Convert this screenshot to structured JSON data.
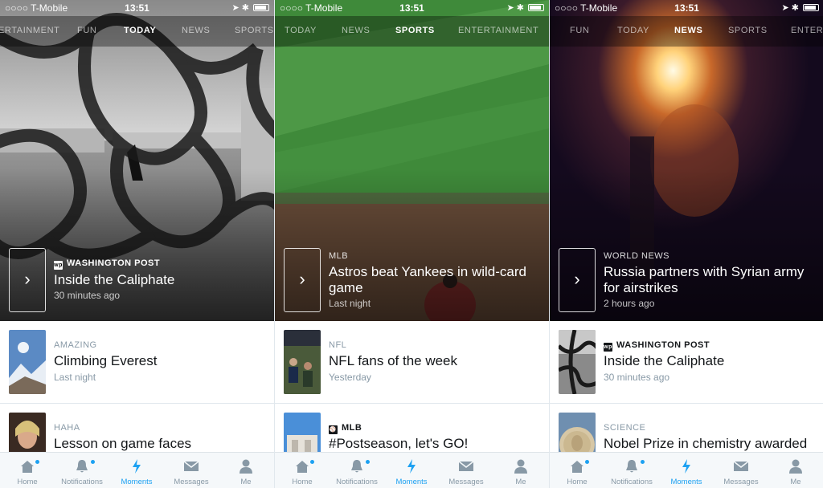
{
  "status": {
    "carrier": "○○○○ T-Mobile",
    "time": "13:51"
  },
  "nav": [
    {
      "label": "Home",
      "icon": "home-icon"
    },
    {
      "label": "Notifications",
      "icon": "bell-icon"
    },
    {
      "label": "Moments",
      "icon": "lightning-icon"
    },
    {
      "label": "Messages",
      "icon": "envelope-icon"
    },
    {
      "label": "Me",
      "icon": "person-icon"
    }
  ],
  "colors": {
    "accent": "#1da1f2",
    "muted": "#8899a6",
    "text": "#14171a"
  },
  "screens": [
    {
      "tabs": [
        "ERTAINMENT",
        "FUN",
        "TODAY",
        "NEWS",
        "SPORTS"
      ],
      "active_tab": "TODAY",
      "hero": {
        "category": "WASHINGTON POST",
        "publisher_logo": "wp",
        "title": "Inside the Caliphate",
        "time": "30 minutes ago"
      },
      "items": [
        {
          "category": "AMAZING",
          "title": "Climbing Everest",
          "time": "Last night"
        },
        {
          "category": "HAHA",
          "title": "Lesson on game faces",
          "time": ""
        }
      ]
    },
    {
      "tabs": [
        "TODAY",
        "NEWS",
        "SPORTS",
        "ENTERTAINMENT"
      ],
      "active_tab": "SPORTS",
      "hero": {
        "category": "MLB",
        "title": "Astros beat Yankees in wild-card game",
        "time": "Last night"
      },
      "items": [
        {
          "category": "NFL",
          "title": "NFL fans of the week",
          "time": "Yesterday"
        },
        {
          "category": "MLB",
          "title": "#Postseason, let's GO!",
          "time": "",
          "publisher_logo": "mlb"
        }
      ]
    },
    {
      "tabs": [
        "FUN",
        "TODAY",
        "NEWS",
        "SPORTS",
        "ENTERT"
      ],
      "active_tab": "NEWS",
      "hero": {
        "category": "WORLD NEWS",
        "title": "Russia partners with Syrian army for airstrikes",
        "time": "2 hours ago"
      },
      "items": [
        {
          "category": "WASHINGTON POST",
          "title": "Inside the Caliphate",
          "time": "30 minutes ago",
          "publisher_logo": "wp"
        },
        {
          "category": "SCIENCE",
          "title": "Nobel Prize in chemistry awarded",
          "time": ""
        }
      ]
    }
  ]
}
